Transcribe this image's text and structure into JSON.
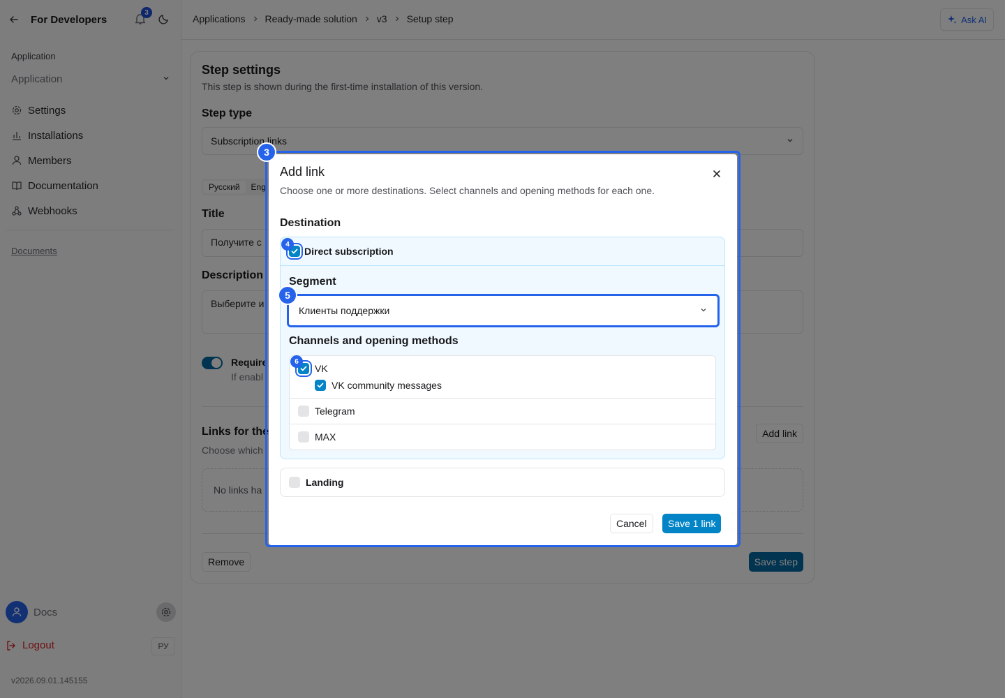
{
  "sidebar": {
    "title": "For Developers",
    "notification_count": "3",
    "group_label": "Application",
    "app_select": "Application",
    "nav": [
      "Settings",
      "Installations",
      "Members",
      "Documentation",
      "Webhooks"
    ],
    "docs_link": "Documents",
    "user_name": "Docs",
    "logout": "Logout",
    "lang": "РУ",
    "version": "v2026.09.01.145155"
  },
  "topbar": {
    "breadcrumb": [
      "Applications",
      "Ready-made solution",
      "v3",
      "Setup step"
    ],
    "ask_ai": "Ask AI"
  },
  "step": {
    "title": "Step settings",
    "subtitle": "This step is shown during the first-time installation of this version.",
    "type_label": "Step type",
    "type_value": "Subscription links",
    "lang_tabs": [
      "Русский",
      "Eng"
    ],
    "title_label": "Title",
    "title_value": "Получите с",
    "description_label": "Description",
    "description_value": "Выберите и",
    "toggle_label": "Require",
    "toggle_hint": "If enabl",
    "links_title": "Links for the",
    "links_sub": "Choose which",
    "add_link": "Add link",
    "empty_text": "No links ha",
    "remove": "Remove",
    "save": "Save step"
  },
  "modal": {
    "title": "Add link",
    "subtitle": "Choose one or more destinations. Select channels and opening methods for each one.",
    "destination_label": "Destination",
    "direct_subscription": "Direct subscription",
    "segment_label": "Segment",
    "segment_value": "Клиенты поддержки",
    "channels_label": "Channels and opening methods",
    "channels": [
      {
        "name": "VK",
        "checked": true,
        "sub": "VK community messages",
        "sub_checked": true
      },
      {
        "name": "Telegram",
        "checked": false
      },
      {
        "name": "MAX",
        "checked": false
      }
    ],
    "landing": "Landing",
    "cancel": "Cancel",
    "save": "Save 1 link"
  },
  "markers": [
    "3",
    "4",
    "5",
    "6"
  ],
  "colors": {
    "accent": "#0284c7",
    "marker": "#2563eb",
    "logout": "#dc2626"
  }
}
